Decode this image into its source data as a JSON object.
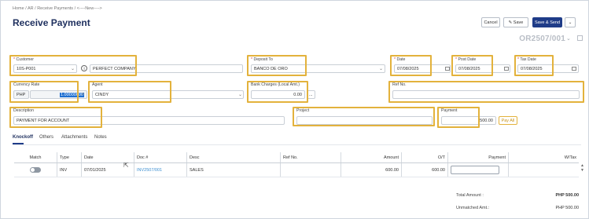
{
  "breadcrumb": [
    "Home",
    "/",
    "AR",
    "/",
    "Receive Payments",
    "/",
    "<----New---->"
  ],
  "page_title": "Receive Payment",
  "toolbar": {
    "cancel": "Cancel",
    "save": "Save",
    "save_send": "Save & Send"
  },
  "document_no": "OR2507/001",
  "form": {
    "customer": {
      "label": "Customer",
      "code": "10S-P001",
      "name": "PERFECT COMPANY"
    },
    "deposit_to": {
      "label": "Deposit To",
      "value": "BANCO DE ORO"
    },
    "date": {
      "label": "Date",
      "value": "07/08/2025"
    },
    "post_date": {
      "label": "Post Date",
      "value": "07/08/2025"
    },
    "tax_date": {
      "label": "Tax Date",
      "value": "07/08/2025"
    },
    "currency_rate": {
      "label": "Currency Rate",
      "currency": "PHP",
      "rate": "1.00000000"
    },
    "agent": {
      "label": "Agent",
      "value": "CINDY"
    },
    "bank_charges": {
      "label": "Bank Charges (Local Amt.)",
      "value": "0.00",
      "more": "..."
    },
    "ref_no": {
      "label": "Ref No.",
      "value": ""
    },
    "description": {
      "label": "Description",
      "value": "PAYMENT FOR ACCOUNT"
    },
    "project": {
      "label": "Project",
      "value": ""
    },
    "payment": {
      "label": "Payment",
      "value": "500.00",
      "pay_all": "Pay All"
    }
  },
  "tabs": [
    "Knockoff",
    "Others",
    "Attachments",
    "Notes"
  ],
  "table": {
    "headers": [
      "Match",
      "Type",
      "Date",
      "Doc #",
      "Desc",
      "Ref No.",
      "Amount",
      "O/T",
      "Payment",
      "W/Tax"
    ],
    "rows": [
      {
        "type": "INV",
        "date": "07/01/2025",
        "doc": "INV2507/001",
        "desc": "SALES",
        "ref": "",
        "amount": "600.00",
        "ot": "600.00",
        "payment": "",
        "wtax": ""
      }
    ]
  },
  "summary": {
    "total_label": "Total Amount :",
    "total_value": "PHP 500.00",
    "unmatched_label": "Unmatched Amt.:",
    "unmatched_value": "PHP 500.00"
  },
  "colors": {
    "highlight": "#e3b23c",
    "primary": "#1f3c88",
    "link": "#3d8fd1"
  }
}
